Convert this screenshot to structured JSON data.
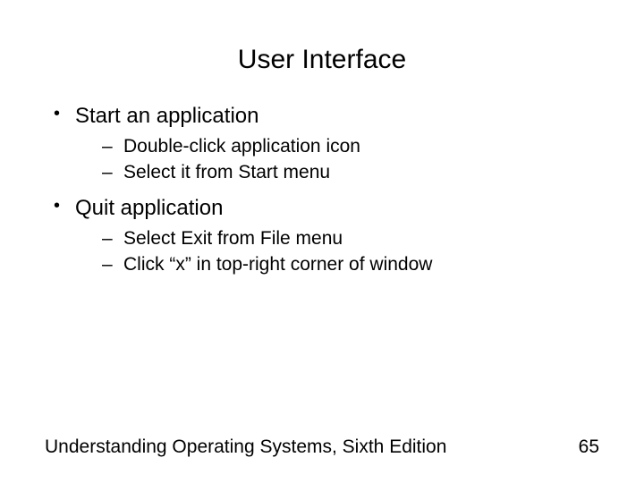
{
  "title": "User Interface",
  "bullets": [
    {
      "text": "Start an application",
      "sub": [
        "Double-click application icon",
        "Select it from Start menu"
      ]
    },
    {
      "text": "Quit application",
      "sub": [
        "Select Exit from File menu",
        "Click “x” in top-right corner of window"
      ]
    }
  ],
  "footer": {
    "source": "Understanding Operating Systems, Sixth Edition",
    "page": "65"
  }
}
